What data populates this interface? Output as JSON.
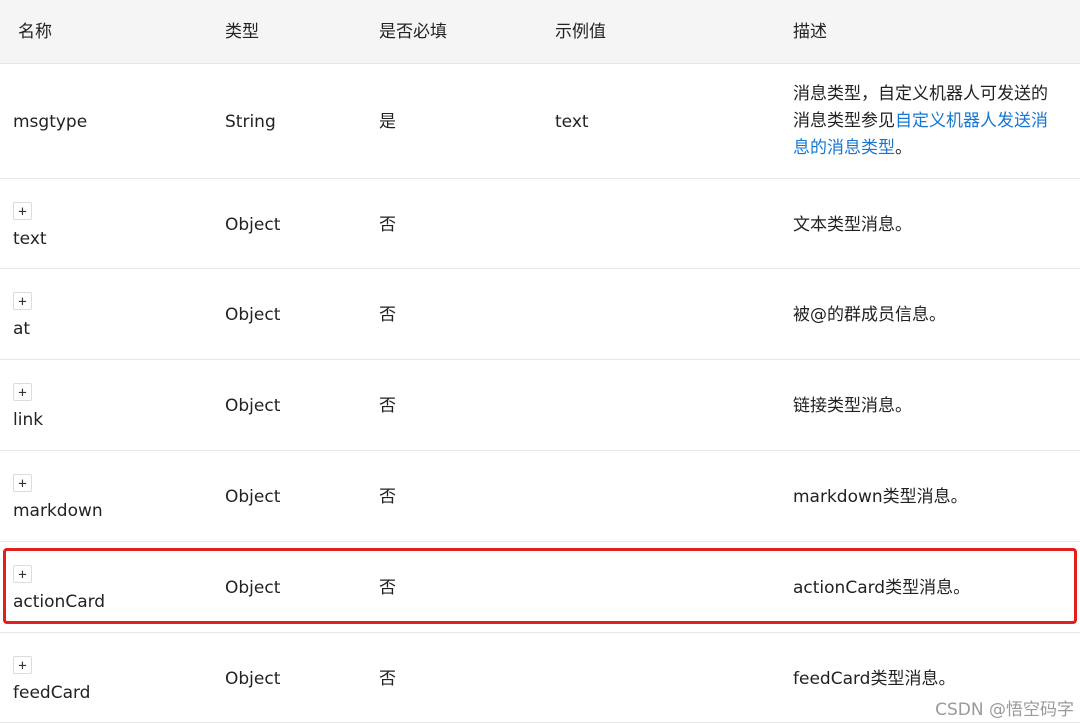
{
  "headers": [
    "名称",
    "类型",
    "是否必填",
    "示例值",
    "描述"
  ],
  "rows": [
    {
      "name": "msgtype",
      "type": "String",
      "required": "是",
      "example": "text",
      "desc_prefix": "消息类型，自定义机器人可发送的消息类型参见",
      "desc_link": "自定义机器人发送消息的消息类型",
      "desc_suffix": "。"
    },
    {
      "expand": "+",
      "name": "text",
      "type": "Object",
      "required": "否",
      "example": "",
      "desc": "文本类型消息。"
    },
    {
      "expand": "+",
      "name": "at",
      "type": "Object",
      "required": "否",
      "example": "",
      "desc": "被@的群成员信息。"
    },
    {
      "expand": "+",
      "name": "link",
      "type": "Object",
      "required": "否",
      "example": "",
      "desc": "链接类型消息。"
    },
    {
      "expand": "+",
      "name": "markdown",
      "type": "Object",
      "required": "否",
      "example": "",
      "desc": "markdown类型消息。"
    },
    {
      "expand": "+",
      "name": "actionCard",
      "type": "Object",
      "required": "否",
      "example": "",
      "desc": "actionCard类型消息。"
    },
    {
      "expand": "+",
      "name": "feedCard",
      "type": "Object",
      "required": "否",
      "example": "",
      "desc": "feedCard类型消息。"
    }
  ],
  "highlight_color": "#e0201c",
  "link_color": "#1677d2",
  "watermark": "CSDN @悟空码字"
}
